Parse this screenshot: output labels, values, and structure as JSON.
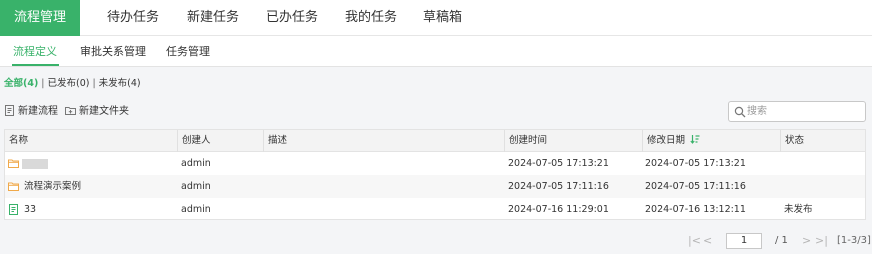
{
  "top_tabs": [
    {
      "label": "流程管理",
      "active": true
    },
    {
      "label": "待办任务"
    },
    {
      "label": "新建任务"
    },
    {
      "label": "已办任务"
    },
    {
      "label": "我的任务"
    },
    {
      "label": "草稿箱"
    }
  ],
  "sub_tabs": [
    {
      "label": "流程定义",
      "active": true
    },
    {
      "label": "审批关系管理"
    },
    {
      "label": "任务管理"
    }
  ],
  "filters": {
    "all": "全部(4)",
    "separator": "|",
    "published": "已发布(0)",
    "unpublished": "未发布(4)"
  },
  "toolbar": {
    "new_process": "新建流程",
    "new_folder": "新建文件夹"
  },
  "search": {
    "placeholder": "搜索",
    "value": ""
  },
  "table": {
    "headers": [
      "名称",
      "创建人",
      "描述",
      "创建时间",
      "修改日期",
      "状态"
    ],
    "rows": [
      {
        "type": "folder",
        "name": "",
        "creator": "admin",
        "description": "",
        "created": "2024-07-05 17:13:21",
        "modified": "2024-07-05 17:13:21",
        "status": ""
      },
      {
        "type": "folder",
        "name": "流程演示案例",
        "creator": "admin",
        "description": "",
        "created": "2024-07-05 17:11:16",
        "modified": "2024-07-05 17:11:16",
        "status": ""
      },
      {
        "type": "process",
        "name": "33",
        "creator": "admin",
        "description": "",
        "created": "2024-07-16 11:29:01",
        "modified": "2024-07-16 13:12:11",
        "status": "未发布"
      }
    ]
  },
  "pagination": {
    "first": "|<",
    "prev": "<",
    "current": "1",
    "total": "/ 1",
    "next": ">",
    "last": ">|",
    "range": "[1-3/3]"
  },
  "colors": {
    "accent": "#39b26a",
    "folder": "#f0a94a",
    "header_bg": "#f3f3f3"
  }
}
